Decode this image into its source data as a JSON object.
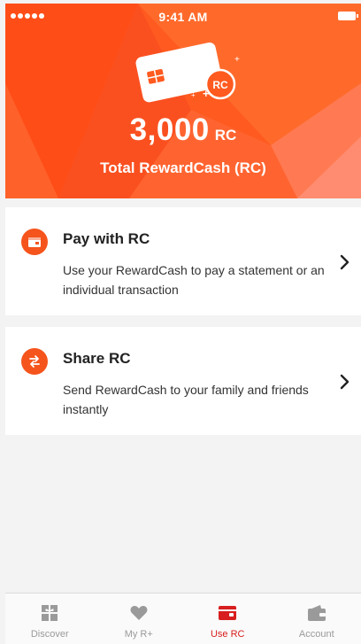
{
  "status_bar": {
    "time": "9:41 AM"
  },
  "hero": {
    "badge": "RC",
    "amount": "3,000",
    "unit": "RC",
    "label": "Total RewardCash (RC)"
  },
  "options": [
    {
      "title": "Pay with RC",
      "description": "Use your RewardCash to pay a statement or an individual transaction",
      "icon": "wallet-icon"
    },
    {
      "title": "Share RC",
      "description": "Send RewardCash to your family and friends instantly",
      "icon": "transfer-icon"
    }
  ],
  "tabbar": {
    "tabs": [
      {
        "label": "Discover",
        "icon": "gift-icon",
        "active": false
      },
      {
        "label": "My R+",
        "icon": "heart-icon",
        "active": false
      },
      {
        "label": "Use RC",
        "icon": "wallet-icon",
        "active": true
      },
      {
        "label": "Account",
        "icon": "purse-icon",
        "active": false
      }
    ]
  },
  "colors": {
    "accent": "#f5541c",
    "hero_base": "#ff5a1f",
    "active_tab": "#d81e1e",
    "inactive_tab": "#9a9a9a"
  }
}
